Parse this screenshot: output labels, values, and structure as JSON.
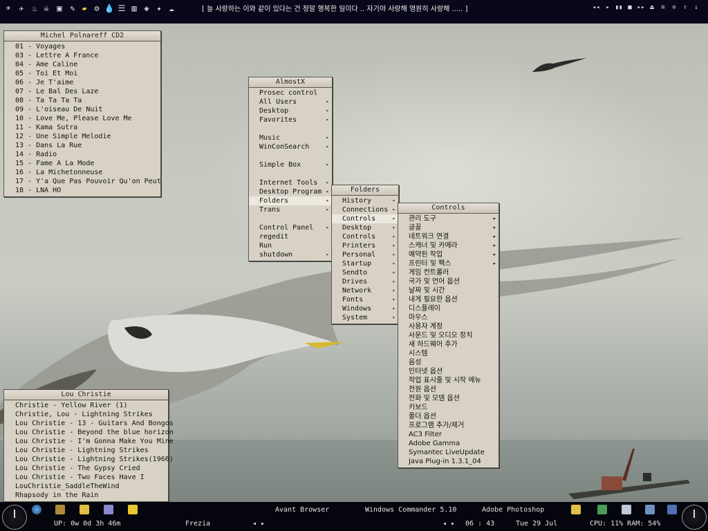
{
  "topbar": {
    "ticker": "[    늘 사랑하는 이와 같이 있다는 건 정말 행복한 일이다 .. 자기야 사랑해 영원히 사랑해 .....   ]",
    "media_buttons": [
      "◂◂",
      "▸",
      "▮▮",
      "■",
      "▸▸",
      "⏏",
      "≡",
      "⊙",
      "↑",
      "↓"
    ]
  },
  "winamp_playlist": {
    "title": "Michel Polnareff CD2",
    "items": [
      "01 - Voyages",
      "03 - Lettre A France",
      "04 - Ame Caline",
      "05 - Toi Et Moi",
      "06 - Je T'aime",
      "07 - Le Bal Des Laze",
      "08 - Ta Ta Ta Ta",
      "09 - L'oiseau De Nuit",
      "10 - Love Me, Please Love Me",
      "11 - Kama Sutra",
      "12 - Une Simple Melodie",
      "13 - Dans La Rue",
      "14 - Radio",
      "15 - Fame A La Mode",
      "16 - La Michetonneuse",
      "17 - Y'a Que Pas Pouvoir Qu'on Peut",
      "18 - LNA HO"
    ]
  },
  "playlist2": {
    "title": "Lou Christie",
    "items": [
      "Christie - Yellow River (1)",
      "Christie, Lou - Lightning Strikes",
      "Lou Christie - 13 - Guitars And Bongos",
      "Lou Christie - Beyond the blue horizon",
      "Lou Christie - I'm Gonna Make You Mine",
      "Lou Christie - Lightning Strikes",
      "Lou Christie - Lightning Strikes(1966)",
      "Lou Christie - The Gypsy Cried",
      "Lou Christie - Two Faces Have I",
      "LouChristie_SaddleTheWind",
      "Rhapsody in the Rain"
    ]
  },
  "menu_almostx": {
    "title": "AlmostX",
    "items": [
      {
        "label": "Prosec control",
        "arrow": false
      },
      {
        "label": "All Users",
        "arrow": true
      },
      {
        "label": "Desktop",
        "arrow": true
      },
      {
        "label": "Favorites",
        "arrow": true
      },
      {
        "label": "",
        "gap": true
      },
      {
        "label": "Music",
        "arrow": true
      },
      {
        "label": "WinConSearch",
        "arrow": true
      },
      {
        "label": "",
        "gap": true
      },
      {
        "label": "Simple Box",
        "arrow": true
      },
      {
        "label": "",
        "gap": true
      },
      {
        "label": "Internet Tools",
        "arrow": true
      },
      {
        "label": "Desktop Program",
        "arrow": true
      },
      {
        "label": "Folders",
        "arrow": true,
        "selected": true
      },
      {
        "label": "Trans",
        "arrow": true
      },
      {
        "label": "",
        "gap": true
      },
      {
        "label": "Control Panel",
        "arrow": true
      },
      {
        "label": "regedit",
        "arrow": false
      },
      {
        "label": "Run",
        "arrow": false
      },
      {
        "label": "shutdown",
        "arrow": true
      }
    ]
  },
  "menu_folders": {
    "title": "Folders",
    "items": [
      {
        "label": "History",
        "arrow": true
      },
      {
        "label": "Connections",
        "arrow": true
      },
      {
        "label": "Controls",
        "arrow": true,
        "selected": true
      },
      {
        "label": "Desktop",
        "arrow": true
      },
      {
        "label": "Controls",
        "arrow": true
      },
      {
        "label": "Printers",
        "arrow": true
      },
      {
        "label": "Personal",
        "arrow": true
      },
      {
        "label": "Startup",
        "arrow": true
      },
      {
        "label": "Sendto",
        "arrow": true
      },
      {
        "label": "Drives",
        "arrow": true
      },
      {
        "label": "Network",
        "arrow": true
      },
      {
        "label": "Fonts",
        "arrow": true
      },
      {
        "label": "Windows",
        "arrow": true
      },
      {
        "label": "System",
        "arrow": true
      }
    ]
  },
  "menu_controls": {
    "title": "Controls",
    "items": [
      {
        "label": "관리 도구",
        "arrow": true
      },
      {
        "label": "글꼴",
        "arrow": true
      },
      {
        "label": "네트워크 연결",
        "arrow": true
      },
      {
        "label": "스캐너 및 카메라",
        "arrow": true
      },
      {
        "label": "예약된 작업",
        "arrow": true
      },
      {
        "label": "프린터 및 팩스",
        "arrow": true
      },
      {
        "label": "게임 컨트롤러",
        "arrow": false
      },
      {
        "label": "국가 및 언어 옵션",
        "arrow": false
      },
      {
        "label": "날짜 및 시간",
        "arrow": false
      },
      {
        "label": "내게 필요한 옵션",
        "arrow": false
      },
      {
        "label": "디스플레이",
        "arrow": false
      },
      {
        "label": "마우스",
        "arrow": false
      },
      {
        "label": "사용자 계정",
        "arrow": false
      },
      {
        "label": "사운드 및 오디오 장치",
        "arrow": false
      },
      {
        "label": "새 하드웨어 추가",
        "arrow": false
      },
      {
        "label": "시스템",
        "arrow": false
      },
      {
        "label": "음성",
        "arrow": false
      },
      {
        "label": "인터넷 옵션",
        "arrow": false
      },
      {
        "label": "작업 표시줄 및 시작 메뉴",
        "arrow": false
      },
      {
        "label": "전원 옵션",
        "arrow": false
      },
      {
        "label": "전화 및 모뎀 옵션",
        "arrow": false
      },
      {
        "label": "키보드",
        "arrow": false
      },
      {
        "label": "폴더 옵션",
        "arrow": false
      },
      {
        "label": "프로그램 추가/제거",
        "arrow": false
      },
      {
        "label": "AC3 Filter",
        "arrow": false
      },
      {
        "label": "Adobe Gamma",
        "arrow": false
      },
      {
        "label": "Symantec LiveUpdate",
        "arrow": false
      },
      {
        "label": "Java Plug-in 1.3.1_04",
        "arrow": false
      }
    ]
  },
  "bottombar": {
    "uptime": "UP: 0w 0d 3h 46m",
    "username": "Frezia",
    "tasks": [
      "Avant Browser",
      "Windows Commander 5.10",
      "Adobe Photoshop"
    ],
    "time": "06 : 43",
    "date": "Tue  29  Jul",
    "stats": "CPU: 11% RAM: 54%",
    "nav_left": "◂  ▸",
    "nav_right": "◂  ▸"
  }
}
